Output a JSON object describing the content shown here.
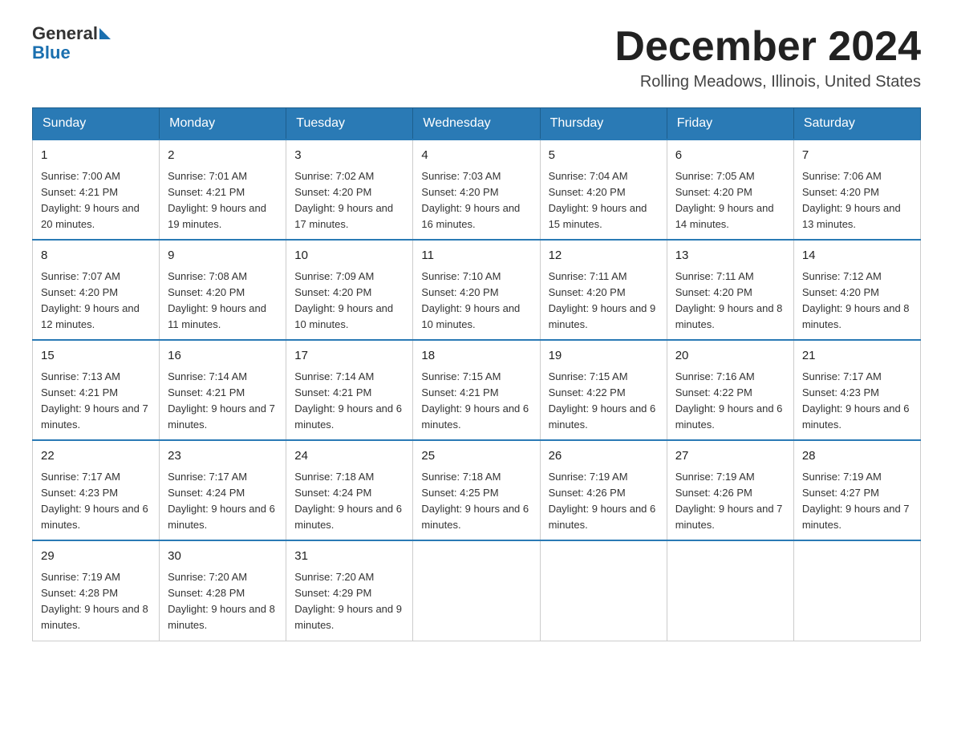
{
  "logo": {
    "text_general": "General",
    "text_blue": "Blue"
  },
  "title": "December 2024",
  "subtitle": "Rolling Meadows, Illinois, United States",
  "days_of_week": [
    "Sunday",
    "Monday",
    "Tuesday",
    "Wednesday",
    "Thursday",
    "Friday",
    "Saturday"
  ],
  "weeks": [
    [
      {
        "day": "1",
        "sunrise": "7:00 AM",
        "sunset": "4:21 PM",
        "daylight": "9 hours and 20 minutes."
      },
      {
        "day": "2",
        "sunrise": "7:01 AM",
        "sunset": "4:21 PM",
        "daylight": "9 hours and 19 minutes."
      },
      {
        "day": "3",
        "sunrise": "7:02 AM",
        "sunset": "4:20 PM",
        "daylight": "9 hours and 17 minutes."
      },
      {
        "day": "4",
        "sunrise": "7:03 AM",
        "sunset": "4:20 PM",
        "daylight": "9 hours and 16 minutes."
      },
      {
        "day": "5",
        "sunrise": "7:04 AM",
        "sunset": "4:20 PM",
        "daylight": "9 hours and 15 minutes."
      },
      {
        "day": "6",
        "sunrise": "7:05 AM",
        "sunset": "4:20 PM",
        "daylight": "9 hours and 14 minutes."
      },
      {
        "day": "7",
        "sunrise": "7:06 AM",
        "sunset": "4:20 PM",
        "daylight": "9 hours and 13 minutes."
      }
    ],
    [
      {
        "day": "8",
        "sunrise": "7:07 AM",
        "sunset": "4:20 PM",
        "daylight": "9 hours and 12 minutes."
      },
      {
        "day": "9",
        "sunrise": "7:08 AM",
        "sunset": "4:20 PM",
        "daylight": "9 hours and 11 minutes."
      },
      {
        "day": "10",
        "sunrise": "7:09 AM",
        "sunset": "4:20 PM",
        "daylight": "9 hours and 10 minutes."
      },
      {
        "day": "11",
        "sunrise": "7:10 AM",
        "sunset": "4:20 PM",
        "daylight": "9 hours and 10 minutes."
      },
      {
        "day": "12",
        "sunrise": "7:11 AM",
        "sunset": "4:20 PM",
        "daylight": "9 hours and 9 minutes."
      },
      {
        "day": "13",
        "sunrise": "7:11 AM",
        "sunset": "4:20 PM",
        "daylight": "9 hours and 8 minutes."
      },
      {
        "day": "14",
        "sunrise": "7:12 AM",
        "sunset": "4:20 PM",
        "daylight": "9 hours and 8 minutes."
      }
    ],
    [
      {
        "day": "15",
        "sunrise": "7:13 AM",
        "sunset": "4:21 PM",
        "daylight": "9 hours and 7 minutes."
      },
      {
        "day": "16",
        "sunrise": "7:14 AM",
        "sunset": "4:21 PM",
        "daylight": "9 hours and 7 minutes."
      },
      {
        "day": "17",
        "sunrise": "7:14 AM",
        "sunset": "4:21 PM",
        "daylight": "9 hours and 6 minutes."
      },
      {
        "day": "18",
        "sunrise": "7:15 AM",
        "sunset": "4:21 PM",
        "daylight": "9 hours and 6 minutes."
      },
      {
        "day": "19",
        "sunrise": "7:15 AM",
        "sunset": "4:22 PM",
        "daylight": "9 hours and 6 minutes."
      },
      {
        "day": "20",
        "sunrise": "7:16 AM",
        "sunset": "4:22 PM",
        "daylight": "9 hours and 6 minutes."
      },
      {
        "day": "21",
        "sunrise": "7:17 AM",
        "sunset": "4:23 PM",
        "daylight": "9 hours and 6 minutes."
      }
    ],
    [
      {
        "day": "22",
        "sunrise": "7:17 AM",
        "sunset": "4:23 PM",
        "daylight": "9 hours and 6 minutes."
      },
      {
        "day": "23",
        "sunrise": "7:17 AM",
        "sunset": "4:24 PM",
        "daylight": "9 hours and 6 minutes."
      },
      {
        "day": "24",
        "sunrise": "7:18 AM",
        "sunset": "4:24 PM",
        "daylight": "9 hours and 6 minutes."
      },
      {
        "day": "25",
        "sunrise": "7:18 AM",
        "sunset": "4:25 PM",
        "daylight": "9 hours and 6 minutes."
      },
      {
        "day": "26",
        "sunrise": "7:19 AM",
        "sunset": "4:26 PM",
        "daylight": "9 hours and 6 minutes."
      },
      {
        "day": "27",
        "sunrise": "7:19 AM",
        "sunset": "4:26 PM",
        "daylight": "9 hours and 7 minutes."
      },
      {
        "day": "28",
        "sunrise": "7:19 AM",
        "sunset": "4:27 PM",
        "daylight": "9 hours and 7 minutes."
      }
    ],
    [
      {
        "day": "29",
        "sunrise": "7:19 AM",
        "sunset": "4:28 PM",
        "daylight": "9 hours and 8 minutes."
      },
      {
        "day": "30",
        "sunrise": "7:20 AM",
        "sunset": "4:28 PM",
        "daylight": "9 hours and 8 minutes."
      },
      {
        "day": "31",
        "sunrise": "7:20 AM",
        "sunset": "4:29 PM",
        "daylight": "9 hours and 9 minutes."
      },
      null,
      null,
      null,
      null
    ]
  ]
}
